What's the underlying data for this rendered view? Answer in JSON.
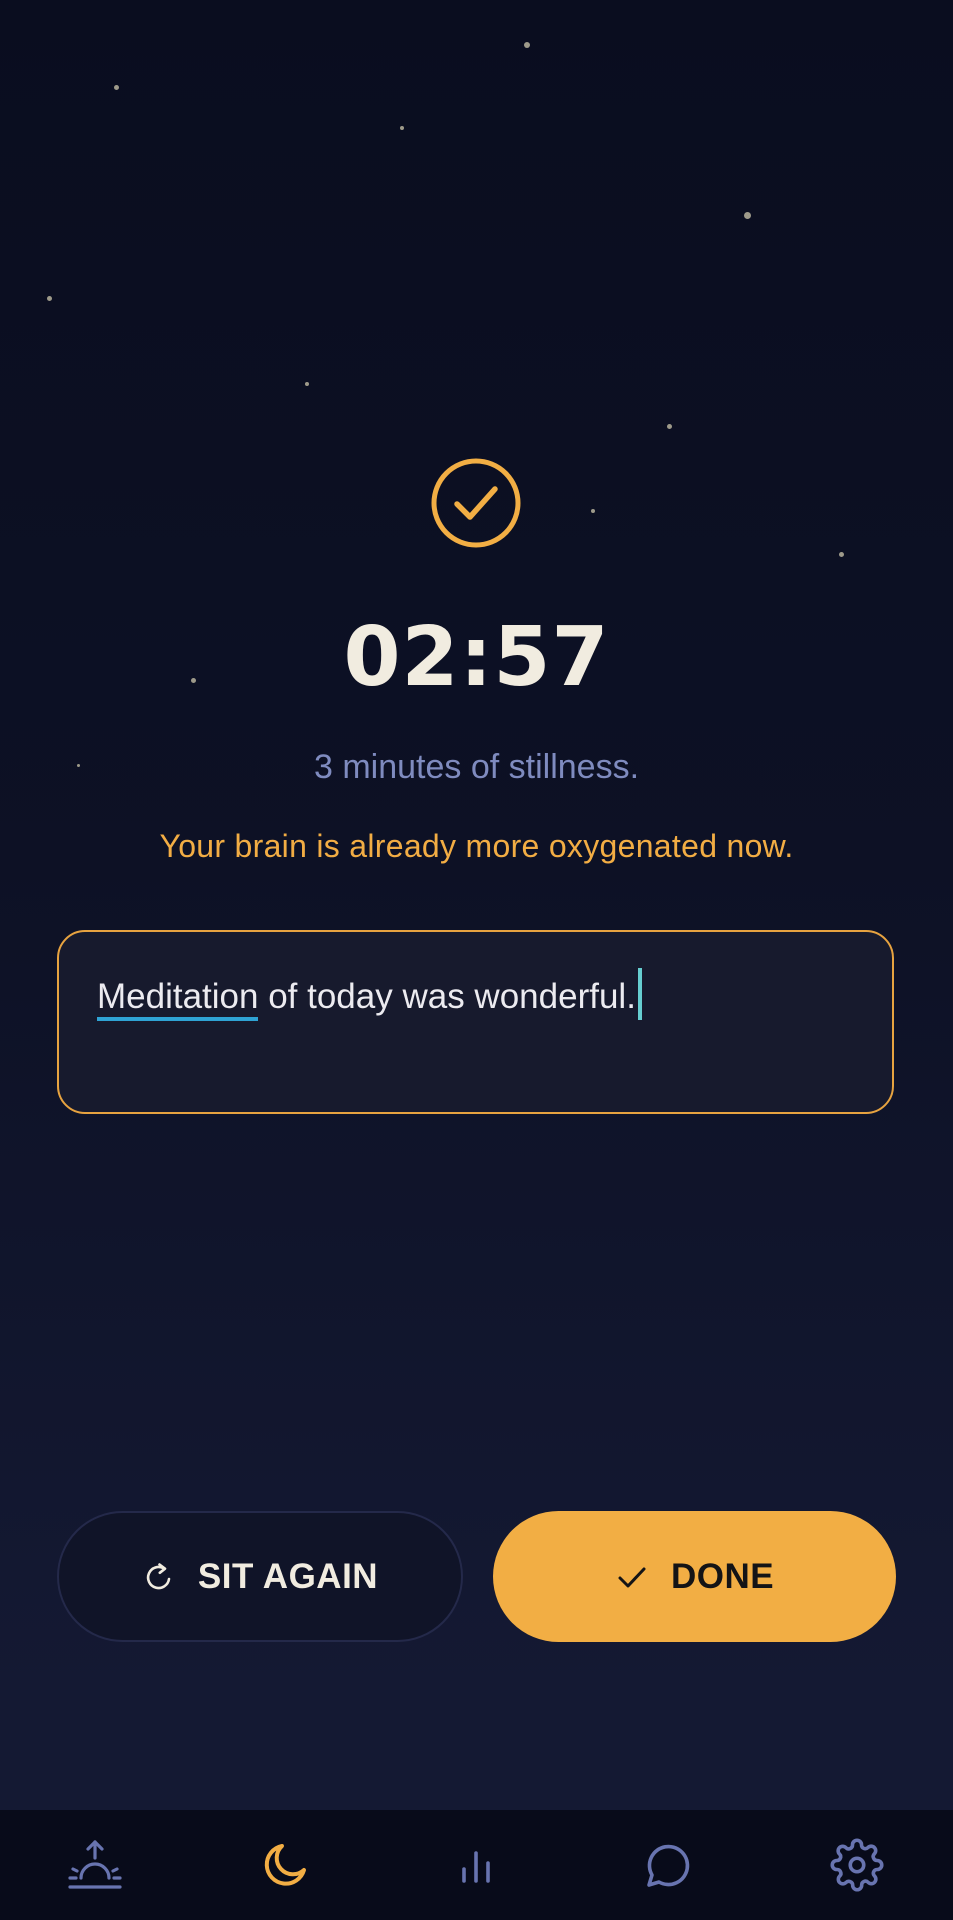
{
  "session": {
    "timer": "02:57",
    "subtitle": "3 minutes of stillness.",
    "highlight": "Your brain is already more oxygenated now."
  },
  "note": {
    "first_word": "Meditation",
    "rest_text": " of today was wonderful."
  },
  "actions": {
    "sit_again_label": "SIT AGAIN",
    "done_label": "DONE"
  },
  "nav": {
    "items": [
      {
        "icon": "sunrise-icon",
        "active": false
      },
      {
        "icon": "moon-icon",
        "active": true
      },
      {
        "icon": "bar-chart-icon",
        "active": false
      },
      {
        "icon": "chat-bubble-icon",
        "active": false
      },
      {
        "icon": "gear-icon",
        "active": false
      }
    ]
  },
  "colors": {
    "accent": "#f2ae44",
    "background": "#0a0d1f",
    "text_muted": "#7f8bbf",
    "text_primary": "#f1ece0",
    "nav_inactive": "#6874b0"
  }
}
